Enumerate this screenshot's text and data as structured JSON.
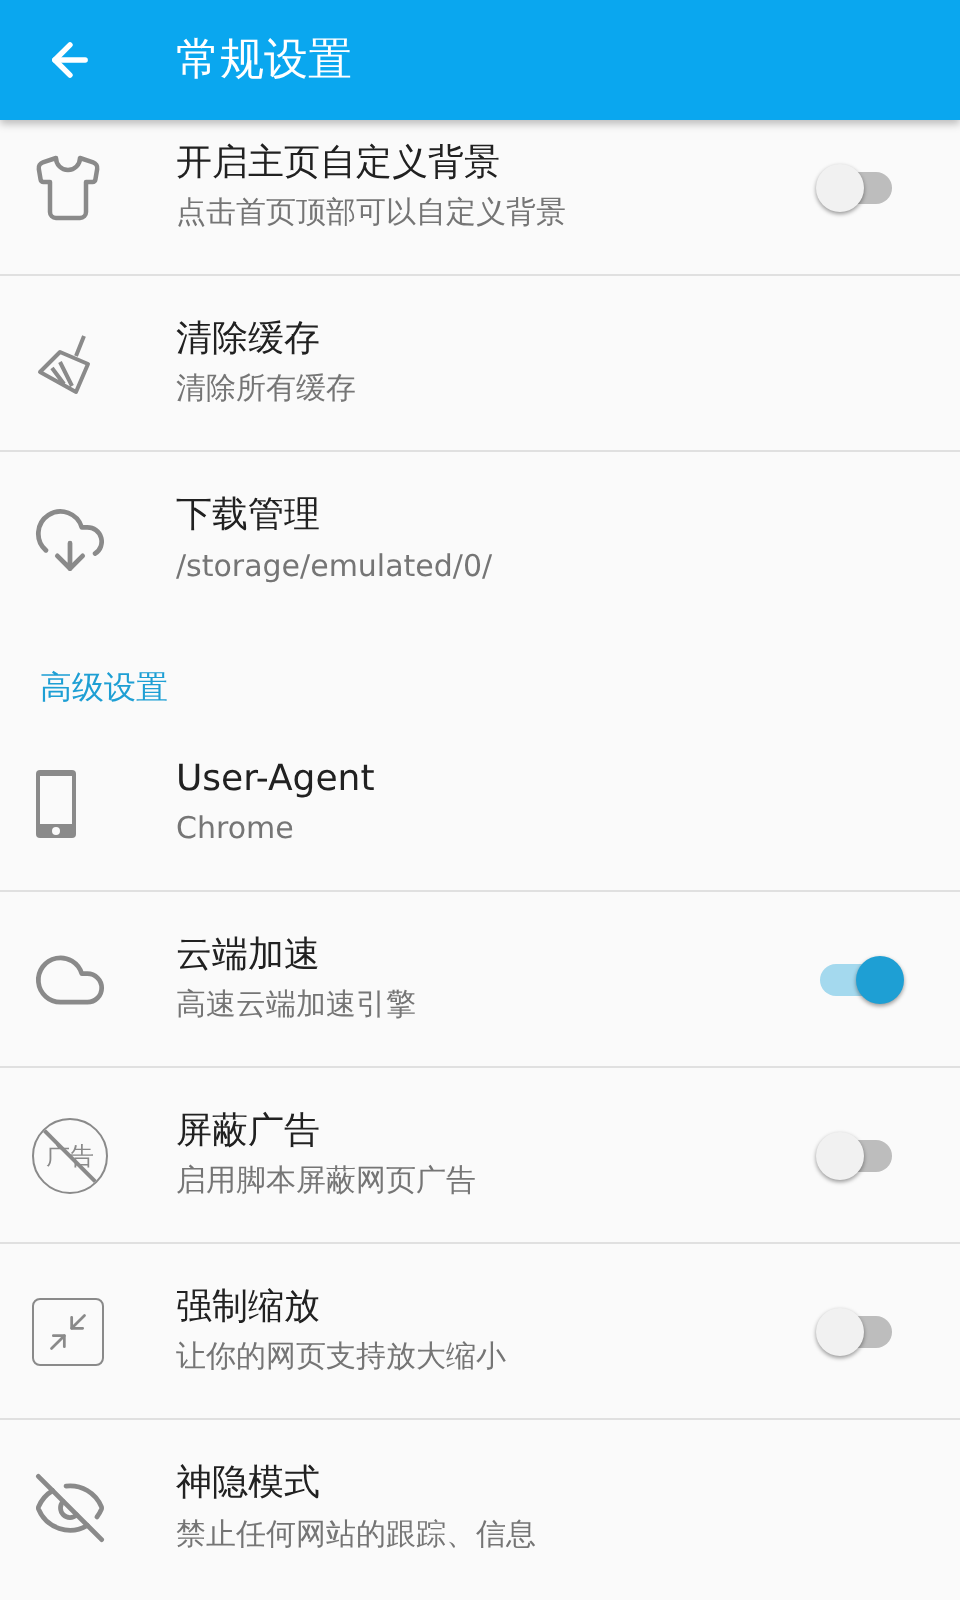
{
  "app_bar": {
    "title": "常规设置"
  },
  "groups": [
    {
      "items": [
        {
          "kind": "switch",
          "title": "开启主页自定义背景",
          "subtitle": "点击首页顶部可以自定义背景",
          "on": false
        },
        {
          "kind": "plain",
          "title": "清除缓存",
          "subtitle": "清除所有缓存"
        },
        {
          "kind": "plain",
          "title": "下载管理",
          "subtitle": "/storage/emulated/0/"
        }
      ]
    },
    {
      "header": "高级设置",
      "items": [
        {
          "kind": "plain",
          "title": "User-Agent",
          "subtitle": "Chrome"
        },
        {
          "kind": "switch",
          "title": "云端加速",
          "subtitle": "高速云端加速引擎",
          "on": true
        },
        {
          "kind": "switch",
          "title": "屏蔽广告",
          "subtitle": "启用脚本屏蔽网页广告",
          "on": false,
          "icon_text": "广告"
        },
        {
          "kind": "switch",
          "title": "强制缩放",
          "subtitle": "让你的网页支持放大缩小",
          "on": false
        },
        {
          "kind": "plain",
          "title": "神隐模式",
          "subtitle": "禁止任何网站的跟踪、信息"
        }
      ]
    }
  ]
}
